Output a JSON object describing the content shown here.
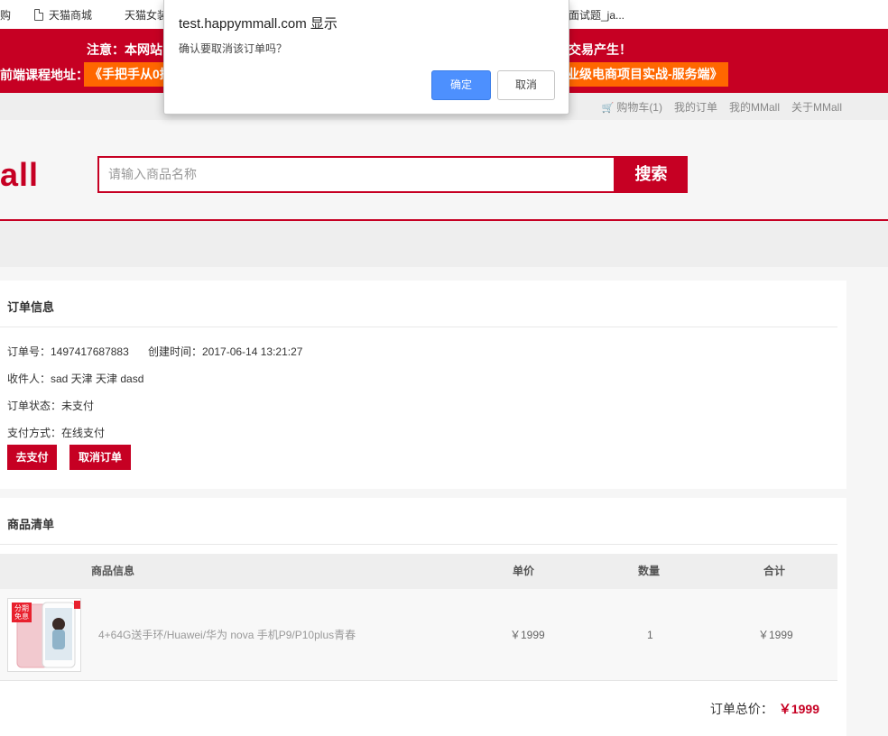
{
  "bookmarks": {
    "items": [
      {
        "label": "购",
        "icon": "none"
      },
      {
        "label": "天猫商城",
        "icon": "document-icon"
      },
      {
        "label": "天猫女装",
        "icon": "grid-icon"
      },
      {
        "label": "面试题_ja...",
        "icon": "none"
      }
    ]
  },
  "notice": {
    "line1_left": "注意：本网站",
    "line1_right": "交易产生！",
    "line2_prefix": "前端课程地址：",
    "link_left": "《手把手从0搭",
    "link_right": "业级电商项目实战-服务端》"
  },
  "topnav": {
    "cart": "购物车(1)",
    "my_orders": "我的订单",
    "my_mmall": "我的MMall",
    "about": "关于MMall"
  },
  "header": {
    "logo": "all",
    "search_placeholder": "请输入商品名称",
    "search_button": "搜索"
  },
  "order_info": {
    "title": "订单信息",
    "order_no": "订单号：1497417687883",
    "created_at": "创建时间：2017-06-14 13:21:27",
    "receiver": "收件人：sad 天津 天津 dasd",
    "status": "订单状态：未支付",
    "payment": "支付方式：在线支付",
    "pay_button": "去支付",
    "cancel_button": "取消订单"
  },
  "goods": {
    "title": "商品清单",
    "columns": {
      "info": "商品信息",
      "price": "单价",
      "qty": "数量",
      "subtotal": "合计"
    },
    "rows": [
      {
        "name": "4+64G送手环/Huawei/华为 nova 手机P9/P10plus青春",
        "price": "￥1999",
        "qty": "1",
        "subtotal": "￥1999",
        "badge": "分期免息"
      }
    ],
    "total_label": "订单总价：",
    "total_value": "￥1999"
  },
  "dialog": {
    "title": "test.happymmall.com 显示",
    "message": "确认要取消该订单吗？",
    "ok": "确定",
    "cancel": "取消"
  },
  "colors": {
    "brand_red": "#c60023",
    "orange": "#ff6700",
    "dialog_blue": "#4d90fe"
  }
}
